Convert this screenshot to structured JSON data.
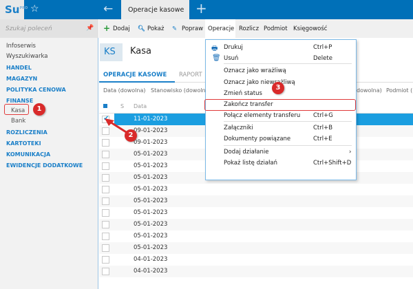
{
  "app": {
    "logo": "Su",
    "logo_sup": "PRO",
    "tab": "Operacje kasowe"
  },
  "sidebar": {
    "search_placeholder": "Szukaj poleceń",
    "items": [
      {
        "label": "Infoserwis"
      },
      {
        "label": "Wyszukiwarka"
      },
      {
        "label": "HANDEL"
      },
      {
        "label": "MAGAZYN"
      },
      {
        "label": "POLITYKA CENOWA"
      },
      {
        "label": "FINANSE"
      },
      {
        "label": "Kasa"
      },
      {
        "label": "Bank"
      },
      {
        "label": "ROZLICZENIA"
      },
      {
        "label": "KARTOTEKI"
      },
      {
        "label": "KOMUNIKACJA"
      },
      {
        "label": "EWIDENCJE DODATKOWE"
      }
    ]
  },
  "toolbar": {
    "add": "Dodaj",
    "show": "Pokaż",
    "edit": "Popraw",
    "operations": "Operacje",
    "settle": "Rozlicz",
    "subject": "Podmiot",
    "accounting": "Księgowość"
  },
  "header": {
    "code": "KS",
    "title": "Kasa"
  },
  "tabs": [
    "OPERACJE KASOWE",
    "RAPORT"
  ],
  "filters": [
    "Data (dowolna)",
    "Stanowisko (dowolne",
    "dowolna)",
    "Podmiot ("
  ],
  "table": {
    "columns": [
      "S",
      "Data"
    ],
    "rows": [
      "11-01-2023",
      "09-01-2023",
      "09-01-2023",
      "05-01-2023",
      "05-01-2023",
      "05-01-2023",
      "05-01-2023",
      "05-01-2023",
      "05-01-2023",
      "05-01-2023",
      "05-01-2023",
      "05-01-2023",
      "04-01-2023",
      "04-01-2023"
    ]
  },
  "menu": [
    {
      "label": "Drukuj",
      "shortcut": "Ctrl+P"
    },
    {
      "label": "Usuń",
      "shortcut": "Delete"
    },
    {
      "label": "Oznacz jako wrażliwą",
      "shortcut": ""
    },
    {
      "label": "Oznacz jako niewrażliwą",
      "shortcut": ""
    },
    {
      "label": "Zmień status",
      "shortcut": ""
    },
    {
      "label": "Zakończ transfer",
      "shortcut": ""
    },
    {
      "label": "Połącz elementy transferu",
      "shortcut": "Ctrl+G"
    },
    {
      "label": "Załączniki",
      "shortcut": "Ctrl+B"
    },
    {
      "label": "Dokumenty powiązane",
      "shortcut": "Ctrl+E"
    },
    {
      "label": "Dodaj działanie",
      "shortcut": "›"
    },
    {
      "label": "Pokaż listę działań",
      "shortcut": "Ctrl+Shift+D"
    }
  ],
  "annotations": [
    "1",
    "2",
    "3"
  ],
  "colors": {
    "brand": "#0070b8",
    "accent": "#1a7fc8",
    "selection": "#1b9ee0",
    "annotation": "#d92a2a"
  }
}
